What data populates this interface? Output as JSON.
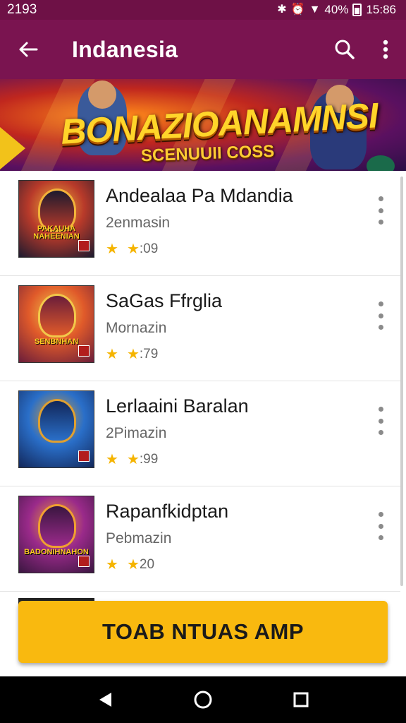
{
  "status_bar": {
    "time_left": "2193",
    "battery_pct": "40%",
    "clock": "15:86"
  },
  "app_bar": {
    "title": "Indanesia"
  },
  "banner": {
    "title": "BONAZIOANAMNSI",
    "subtitle": "SCENUUII COSS"
  },
  "apps": [
    {
      "name": "Andealaa Pa Mdandia",
      "developer": "2enmasin",
      "rating": ":09",
      "thumb_label": "PAKAUHA NAHEENIAN",
      "thumb_colors": [
        "#1d1a2e",
        "#b83a2a",
        "#f2b33a"
      ]
    },
    {
      "name": "SaGas Ffrglia",
      "developer": "Mornazin",
      "rating": ":79",
      "thumb_label": "SENBNHAN",
      "thumb_colors": [
        "#6a1d3a",
        "#e05a2a",
        "#f2c84a"
      ]
    },
    {
      "name": "Lerlaaini Baralan",
      "developer": "2Pimazin",
      "rating": ":99",
      "thumb_label": "",
      "thumb_colors": [
        "#12275a",
        "#2a6fc9",
        "#e0a030"
      ]
    },
    {
      "name": "Rapanfkidptan",
      "developer": "Pebmazin",
      "rating": "20",
      "thumb_label": "BADONIHNAHON",
      "thumb_colors": [
        "#3a1640",
        "#9a2a8a",
        "#f0a030"
      ]
    }
  ],
  "cta": {
    "label": "TOAB NTUAS AMP"
  },
  "colors": {
    "app_bar": "#7a1450",
    "status_bar": "#6e1146",
    "cta": "#f9b90f",
    "star": "#f5b400"
  }
}
